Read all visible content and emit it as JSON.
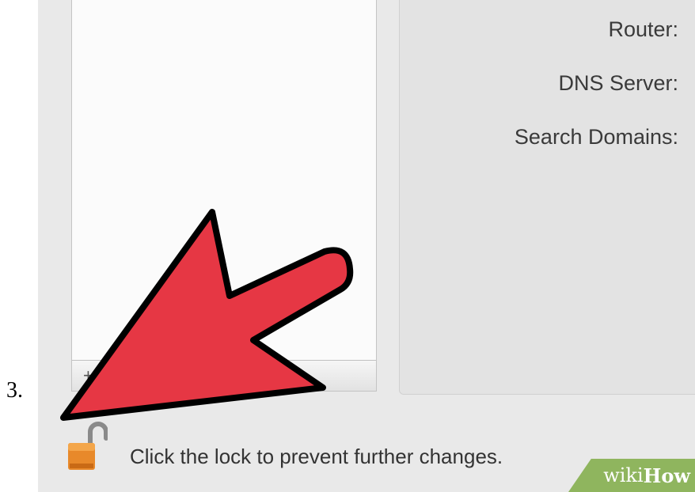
{
  "step": {
    "number": "3."
  },
  "list": {
    "add_label": "+"
  },
  "details": {
    "router_label": "Router:",
    "dns_label": "DNS Server:",
    "search_label": "Search Domains:"
  },
  "lock": {
    "message": "Click the lock to prevent further changes."
  },
  "watermark": {
    "wiki": "wiki",
    "how": "How"
  },
  "colors": {
    "arrow": "#e63744",
    "lock": "#e8892a",
    "watermark": "#8fb55e"
  }
}
